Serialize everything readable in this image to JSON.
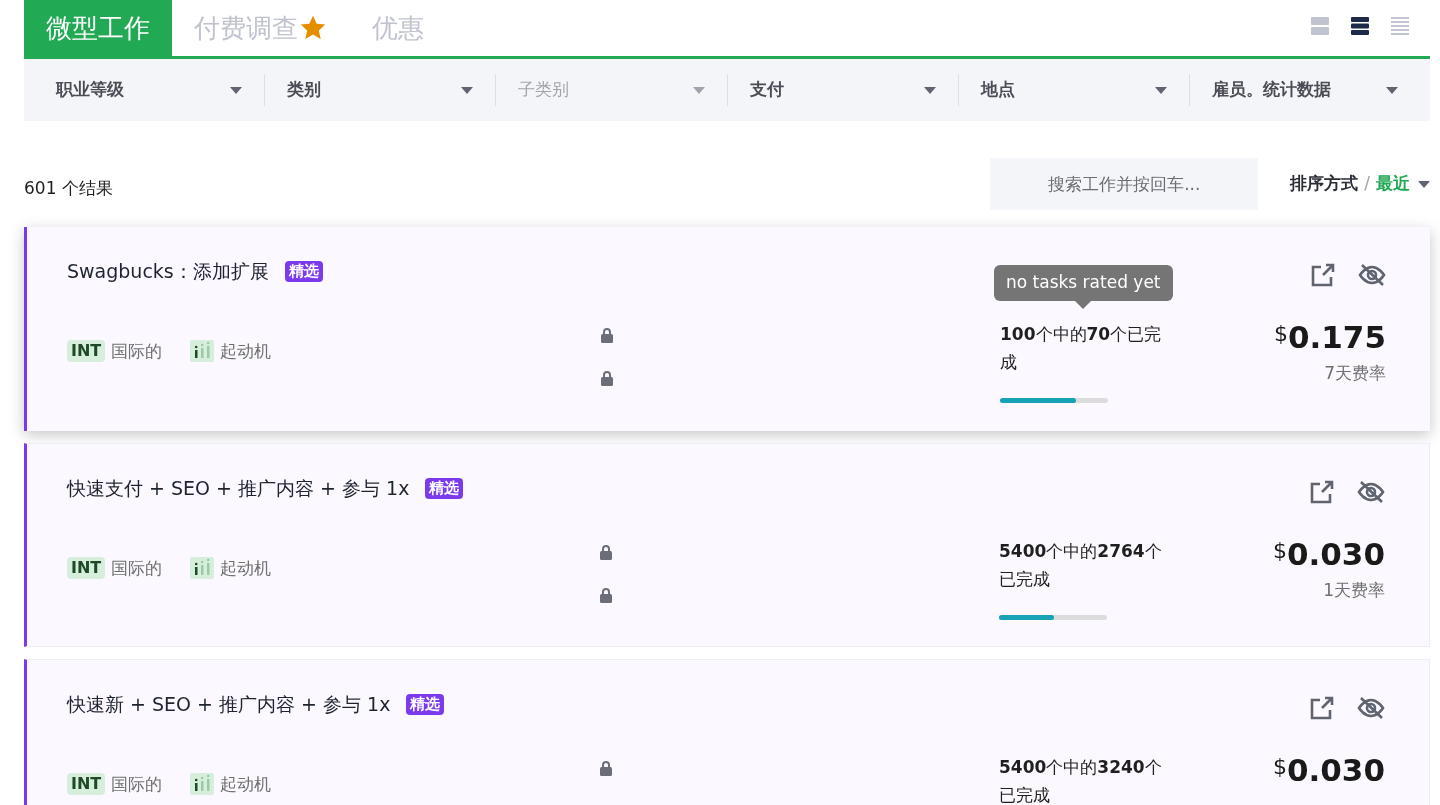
{
  "tabs": [
    {
      "label": "微型工作",
      "selected": true,
      "starred": false
    },
    {
      "label": "付费调查",
      "selected": false,
      "starred": true
    },
    {
      "label": "优惠",
      "selected": false,
      "starred": false
    }
  ],
  "view_modes": [
    {
      "kind": "large",
      "selected": false
    },
    {
      "kind": "medium",
      "selected": true
    },
    {
      "kind": "compact",
      "selected": false
    }
  ],
  "filters": [
    {
      "label": "职业等级",
      "disabled": false
    },
    {
      "label": "类别",
      "disabled": false
    },
    {
      "label": "子类别",
      "disabled": true
    },
    {
      "label": "支付",
      "disabled": false
    },
    {
      "label": "地点",
      "disabled": false
    },
    {
      "label": "雇员。统计数据",
      "disabled": false
    }
  ],
  "results_count": "601 个结果",
  "search": {
    "placeholder": "搜索工作并按回车..."
  },
  "sort": {
    "label": "排序方式",
    "separator": "/",
    "value": "最近"
  },
  "jobs": [
    {
      "title": "Swagbucks：添加扩展",
      "badge": "精选",
      "highlighted": true,
      "tags": [
        {
          "kind": "int",
          "code": "INT",
          "label": "国际的"
        },
        {
          "kind": "level",
          "label": "起动机"
        }
      ],
      "locks": [
        {
          "kind": "lock"
        },
        {
          "kind": "lock"
        }
      ],
      "tooltip": "no tasks rated yet",
      "progress_text": "**100**个中的**70**个已完成",
      "level": 0.7,
      "currency": "$",
      "amount": "0.175",
      "rate": "7天费率"
    },
    {
      "title": "快速支付 + SEO + 推广内容 + 参与 1x",
      "badge": "精选",
      "highlighted": false,
      "tags": [
        {
          "kind": "int",
          "code": "INT",
          "label": "国际的"
        },
        {
          "kind": "level",
          "label": "起动机"
        }
      ],
      "locks": [
        {
          "kind": "lock"
        },
        {
          "kind": "lock"
        }
      ],
      "progress_text": "**5400**个中的**2764**个已完成",
      "level": 0.51,
      "currency": "$",
      "amount": "0.030",
      "rate": "1天费率"
    },
    {
      "title": "快速新 + SEO + 推广内容 + 参与 1x",
      "badge": "精选",
      "highlighted": false,
      "tags": [
        {
          "kind": "int",
          "code": "INT",
          "label": "国际的"
        },
        {
          "kind": "level",
          "label": "起动机"
        }
      ],
      "locks": [
        {
          "kind": "lock"
        }
      ],
      "progress_text": "**5400**个中的**3240**个已完成",
      "currency": "$",
      "amount": "0.030"
    }
  ]
}
